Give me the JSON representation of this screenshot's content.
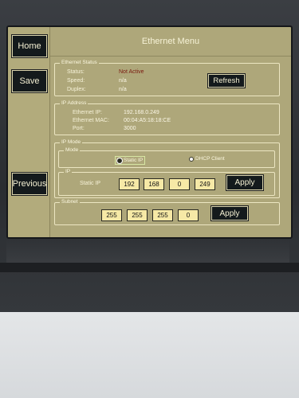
{
  "sidebar": {
    "home_label": "Home",
    "save_label": "Save",
    "previous_label": "Previous"
  },
  "header": {
    "title": "Ethernet Menu"
  },
  "ethernet_status": {
    "legend": "Ethernet Status",
    "status_label": "Status:",
    "status_value": "Not Active",
    "speed_label": "Speed:",
    "speed_value": "n/a",
    "duplex_label": "Duplex:",
    "duplex_value": "n/a",
    "refresh_label": "Refresh",
    "status_color": "#7a1a10"
  },
  "ip_address": {
    "legend": "IP Address",
    "ip_label": "Ethernet IP:",
    "ip_value": "192.168.0.249",
    "mac_label": "Ethernet MAC:",
    "mac_value": "00:04:A5:18:18:CE",
    "port_label": "Port:",
    "port_value": "3000"
  },
  "ip_mode": {
    "legend": "IP Mode",
    "mode_legend": "Mode",
    "static_option": "Static IP",
    "dhcp_option": "DHCP Client",
    "selected": "Static IP",
    "ip_legend": "IP",
    "static_ip_label": "Static IP",
    "octets": [
      "192",
      "168",
      "0",
      "249"
    ],
    "apply_label": "Apply"
  },
  "subnet": {
    "legend": "Subnet",
    "octets": [
      "255",
      "255",
      "255",
      "0"
    ],
    "apply_label": "Apply"
  },
  "colors": {
    "screen_bg": "#aea77a",
    "button_bg": "#141a1c",
    "input_bg": "#f6e9a6"
  }
}
